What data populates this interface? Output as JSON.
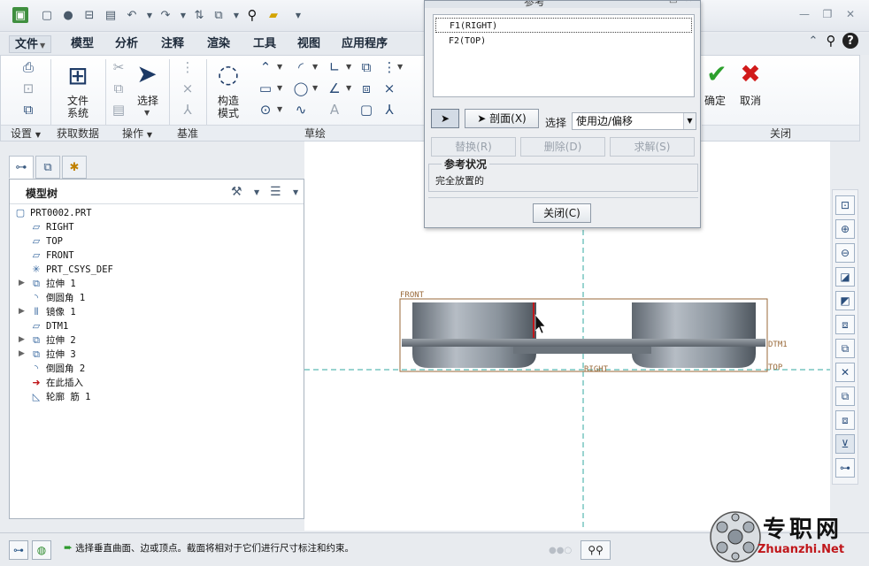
{
  "ribbon_tabs": [
    {
      "label": "文件",
      "has_dropdown": true
    },
    {
      "label": "模型"
    },
    {
      "label": "分析"
    },
    {
      "label": "注释"
    },
    {
      "label": "渲染"
    },
    {
      "label": "工具"
    },
    {
      "label": "视图"
    },
    {
      "label": "应用程序"
    }
  ],
  "ribbon": {
    "file_system_label_1": "文件",
    "file_system_label_2": "系统",
    "select_label": "选择",
    "construct_label_1": "构造",
    "construct_label_2": "模式",
    "confirm_label": "确定",
    "cancel_label": "取消",
    "groups": {
      "settings": "设置",
      "get_data": "获取数据",
      "operations": "操作",
      "datum": "基准",
      "sketch": "草绘",
      "close": "关闭"
    }
  },
  "model_tree": {
    "title": "模型树",
    "items": [
      {
        "label": "PRT0002.PRT",
        "icon": "part-icon",
        "expandable": false
      },
      {
        "label": "RIGHT",
        "icon": "datum-plane-icon",
        "expandable": false
      },
      {
        "label": "TOP",
        "icon": "datum-plane-icon",
        "expandable": false
      },
      {
        "label": "FRONT",
        "icon": "datum-plane-icon",
        "expandable": false
      },
      {
        "label": "PRT_CSYS_DEF",
        "icon": "csys-icon",
        "expandable": false
      },
      {
        "label": "拉伸 1",
        "icon": "extrude-icon",
        "expandable": true
      },
      {
        "label": "倒圆角 1",
        "icon": "round-icon",
        "expandable": false
      },
      {
        "label": "镜像 1",
        "icon": "mirror-icon",
        "expandable": true
      },
      {
        "label": "DTM1",
        "icon": "datum-plane-icon",
        "expandable": false
      },
      {
        "label": "拉伸 2",
        "icon": "extrude-icon",
        "expandable": true
      },
      {
        "label": "拉伸 3",
        "icon": "extrude-icon",
        "expandable": true
      },
      {
        "label": "倒圆角 2",
        "icon": "round-icon",
        "expandable": false
      },
      {
        "label": "在此插入",
        "icon": "insert-here-icon",
        "expandable": false
      },
      {
        "label": "轮廓 筋 1",
        "icon": "rib-icon",
        "expandable": false
      }
    ]
  },
  "graphics": {
    "labels": {
      "front": "FRONT",
      "dtm1": "DTM1",
      "right": "RIGHT",
      "top": "TOP"
    }
  },
  "dialog": {
    "title": "参考",
    "references": [
      "F1(RIGHT)",
      "F2(TOP)"
    ],
    "section_button": "剖面(X)",
    "select_label": "选择",
    "select_value": "使用边/偏移",
    "replace_button": "替换(R)",
    "delete_button": "删除(D)",
    "solve_button": "求解(S)",
    "status_title": "参考状况",
    "status_text": "完全放置的",
    "close_button": "关闭(C)"
  },
  "statusbar": {
    "message": "选择垂直曲面、边或顶点。截面将相对于它们进行尺寸标注和约束。"
  },
  "watermark": {
    "cn": "专职网",
    "en": "Zhuanzhi.Net"
  },
  "colors": {
    "confirm": "#2ca02c",
    "cancel": "#d11a1a",
    "accent": "#2a4c78"
  }
}
